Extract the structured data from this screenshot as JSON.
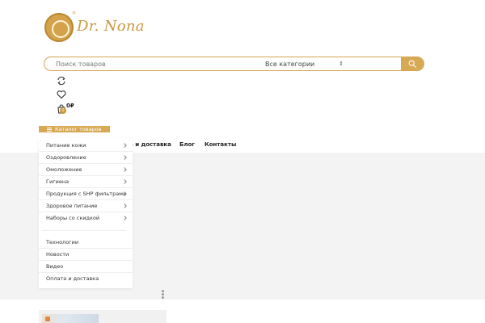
{
  "logo": {
    "brand": "Dr. Nona",
    "registered": "®"
  },
  "search": {
    "placeholder": "Поиск товаров",
    "category": "Все категории"
  },
  "header": {
    "cart_count": "0",
    "cart_total": "0₽"
  },
  "catalog": {
    "button_label": "Каталог товаров",
    "items": [
      {
        "label": "Питание кожи",
        "has_children": true
      },
      {
        "label": "Оздоровление",
        "has_children": true
      },
      {
        "label": "Омоложение",
        "has_children": true
      },
      {
        "label": "Гигиена",
        "has_children": true
      },
      {
        "label": "Продукция с SHP фильтрами",
        "has_children": true
      },
      {
        "label": "Здоровое питание",
        "has_children": true
      },
      {
        "label": "Наборы со скидкой",
        "has_children": true
      }
    ],
    "links": [
      {
        "label": "Технологии"
      },
      {
        "label": "Новости"
      },
      {
        "label": "Видео"
      },
      {
        "label": "Оплата и доставка"
      }
    ]
  },
  "nav": {
    "items": [
      {
        "label": "та и доставка"
      },
      {
        "label": "Блог"
      },
      {
        "label": "Контакты"
      }
    ]
  },
  "colors": {
    "accent": "#d7a955",
    "brand": "#c9973f",
    "hero_bg": "#f3f3f3"
  },
  "icons": [
    "compare-icon",
    "heart-icon",
    "cart-icon",
    "search-icon",
    "menu-icon",
    "chevron-right-icon"
  ]
}
